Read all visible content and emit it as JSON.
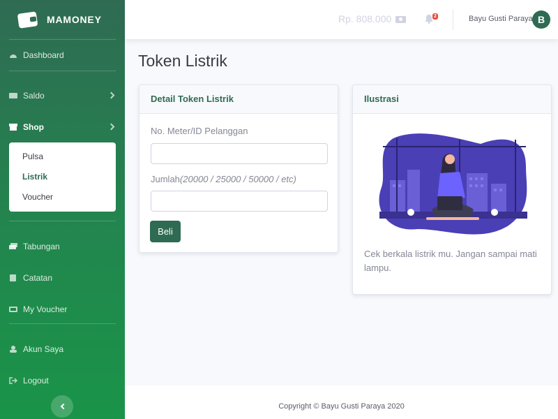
{
  "brand": {
    "name": "MAMONEY",
    "icon": "wallet-icon"
  },
  "sidebar": {
    "items": [
      {
        "label": "Dashboard",
        "icon": "dashboard-icon"
      },
      {
        "label": "Saldo",
        "icon": "wallet-card-icon"
      },
      {
        "label": "Shop",
        "icon": "store-icon"
      },
      {
        "label": "Tabungan",
        "icon": "money-stack-icon"
      },
      {
        "label": "Catatan",
        "icon": "note-icon"
      },
      {
        "label": "My Voucher",
        "icon": "ticket-icon"
      },
      {
        "label": "Akun Saya",
        "icon": "user-icon"
      },
      {
        "label": "Logout",
        "icon": "sign-out-icon"
      }
    ],
    "shop_submenu": [
      "Pulsa",
      "Listrik",
      "Voucher"
    ],
    "active_submenu": "Listrik"
  },
  "topbar": {
    "balance": "Rp. 808.000",
    "notification_count": "2",
    "username": "Bayu Gusti Paraya",
    "avatar_initial": "B"
  },
  "page": {
    "title": "Token Listrik",
    "form_card": {
      "title": "Detail Token Listrik",
      "meter_label": "No. Meter/ID Pelanggan",
      "meter_value": "",
      "amount_label": "Jumlah",
      "amount_hint": "(20000 / 25000 / 50000 / etc)",
      "amount_value": "",
      "submit_label": "Beli"
    },
    "illustration_card": {
      "title": "Ilustrasi",
      "description": "Cek berkala listrik mu. Jangan sampai mati lampu."
    }
  },
  "footer": {
    "copyright": "Copyright © Bayu Gusti Paraya 2020"
  },
  "colors": {
    "primary": "#2f6b53",
    "sidebar_bottom": "#1a9448",
    "badge": "#e74a3b",
    "illustration_purple": "#4f46b8"
  }
}
